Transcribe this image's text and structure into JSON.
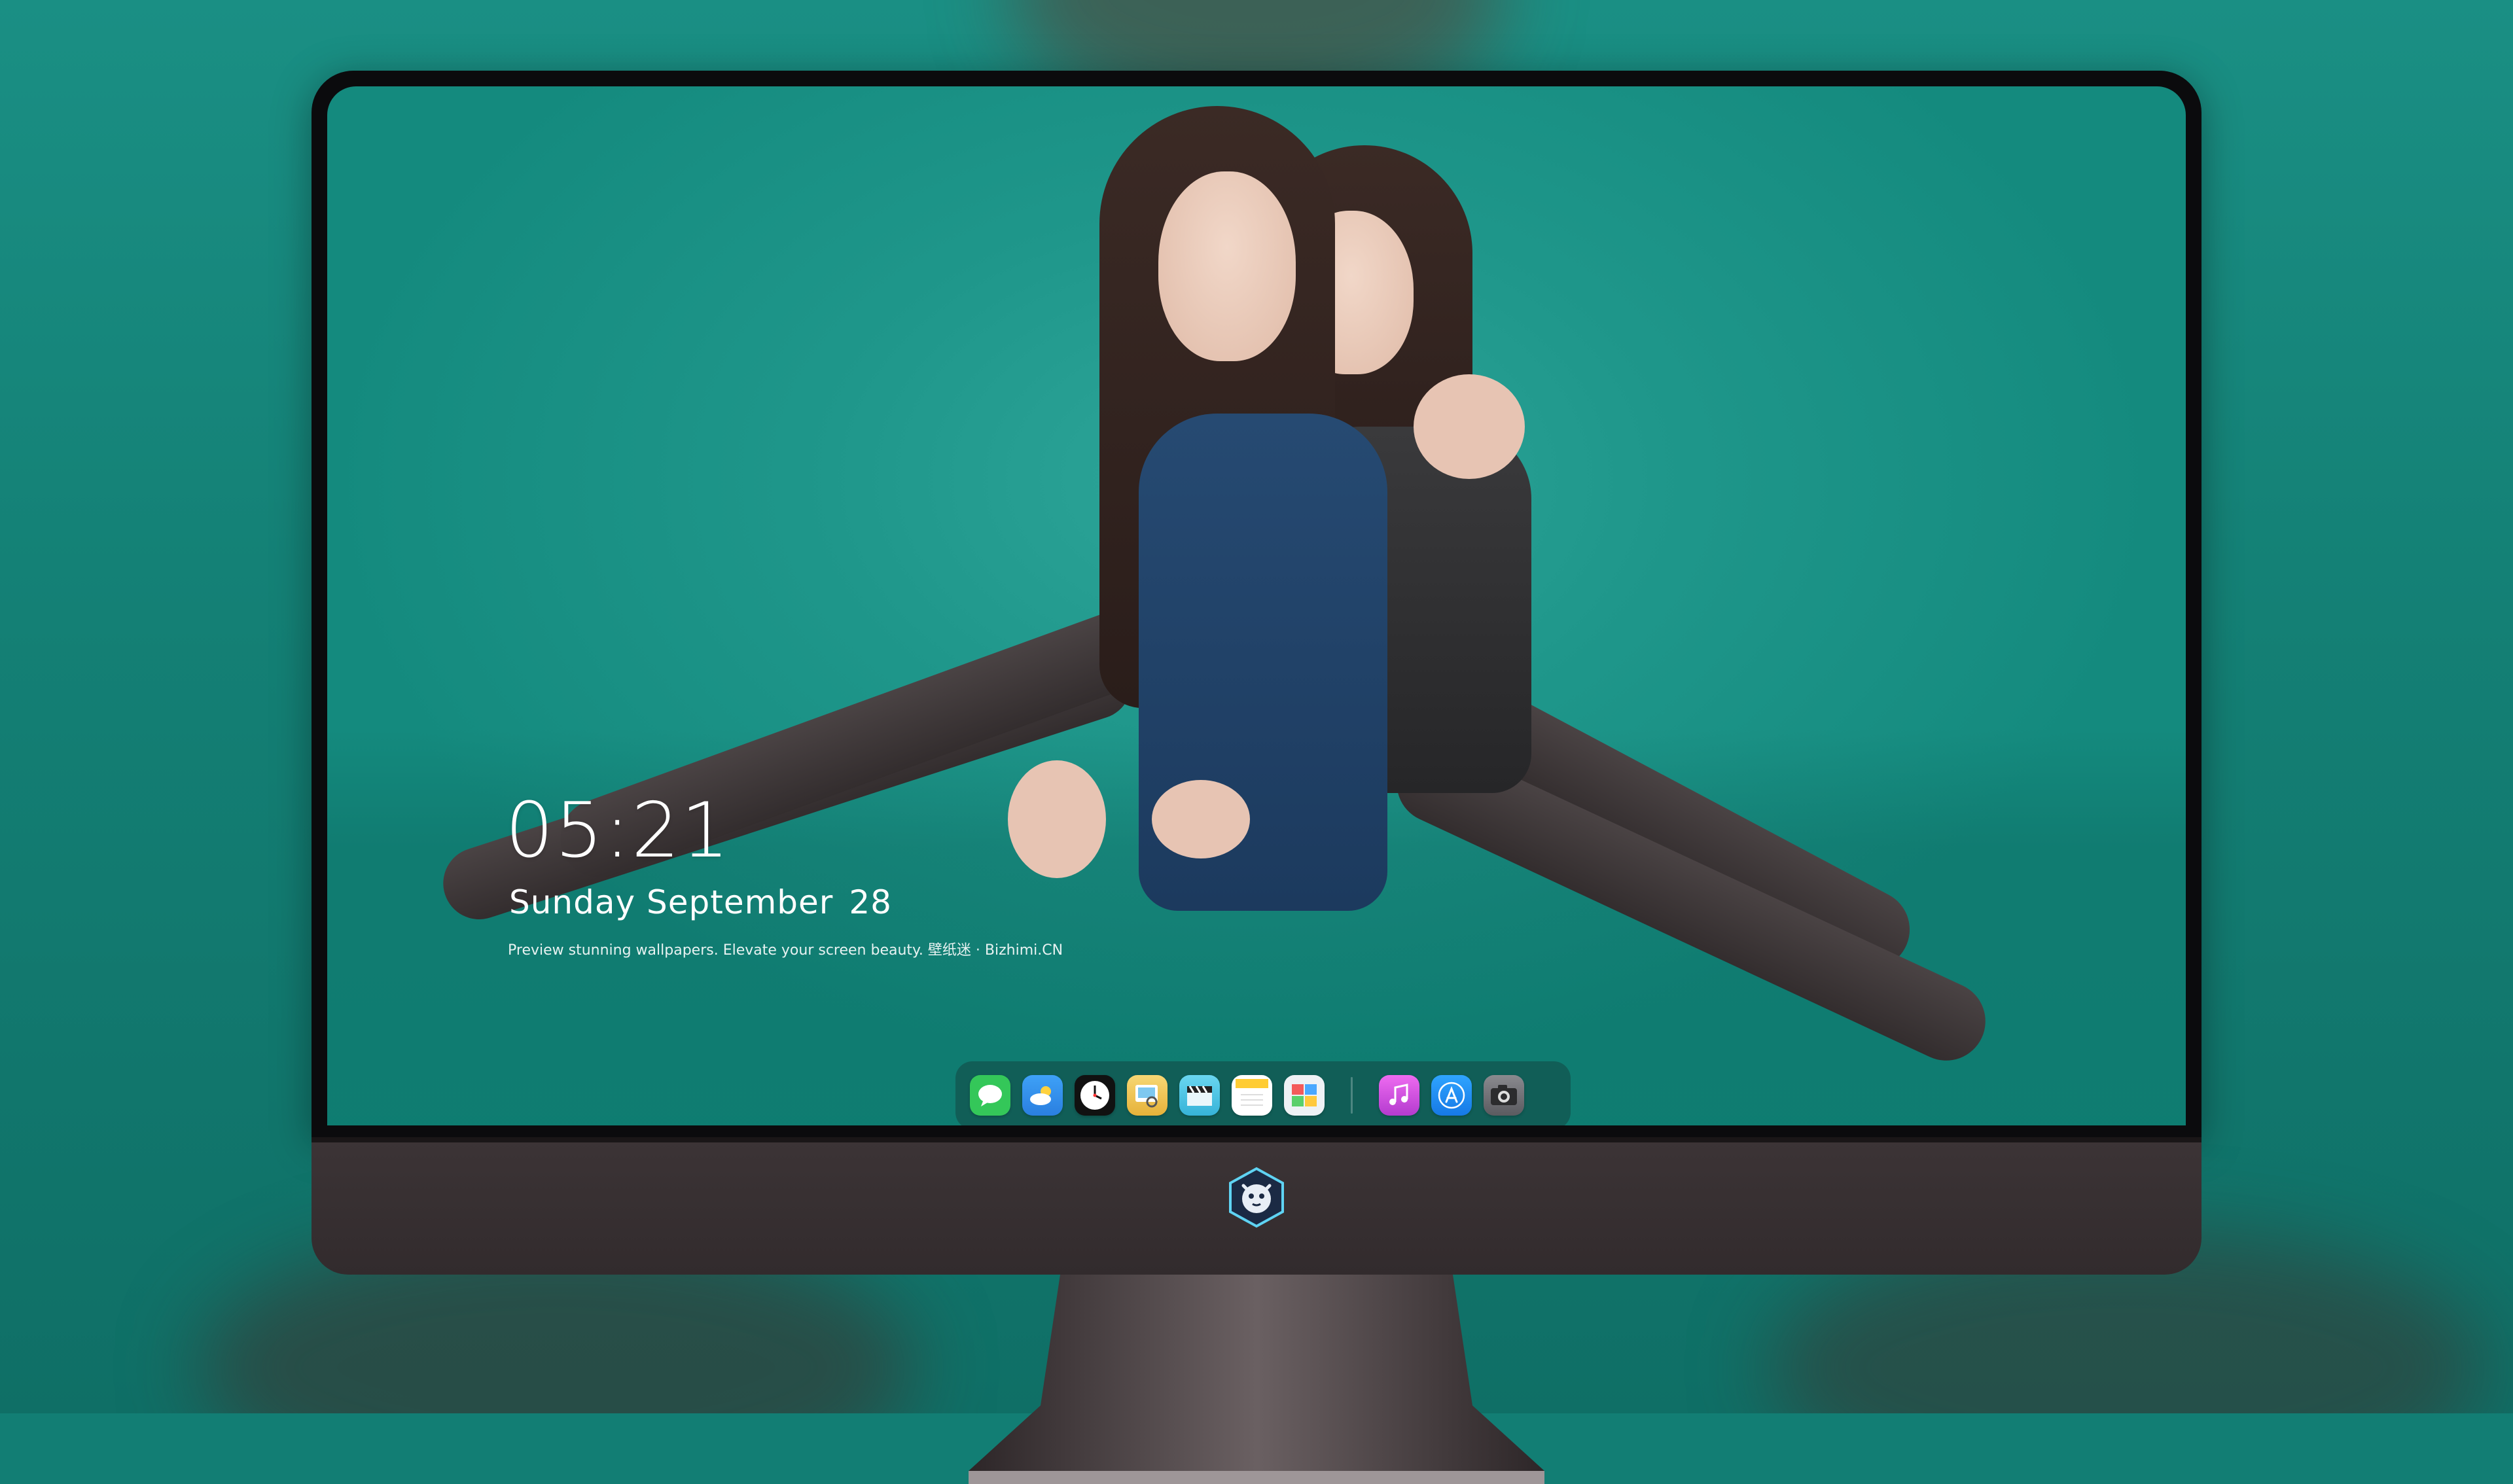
{
  "lockscreen": {
    "time": "05:21",
    "weekday_month": "Sunday September",
    "day": "28",
    "tagline": "Preview stunning wallpapers. Elevate your screen beauty. 壁纸迷 · Bizhimi.CN"
  },
  "dock": {
    "apps": [
      {
        "name": "messages-icon",
        "color": "#34c759"
      },
      {
        "name": "weather-icon",
        "color": "#3b9bf5"
      },
      {
        "name": "clock-icon",
        "color": "#111111"
      },
      {
        "name": "preview-icon",
        "color": "#f4c542"
      },
      {
        "name": "video-icon",
        "color": "#4ec6e8"
      },
      {
        "name": "notes-icon",
        "color": "#ffd54a"
      },
      {
        "name": "photo-editor-icon",
        "color": "#e9eef2"
      },
      {
        "name": "music-icon",
        "color": "#d24cd6"
      },
      {
        "name": "app-store-icon",
        "color": "#1f8bf0"
      },
      {
        "name": "camera-icon",
        "color": "#6e6e73"
      }
    ]
  },
  "colors": {
    "wallpaper_teal": "#1f978b",
    "bezel": "#0b0b0d",
    "chin": "#3c3436",
    "logo_accent": "#5fd3f3"
  }
}
